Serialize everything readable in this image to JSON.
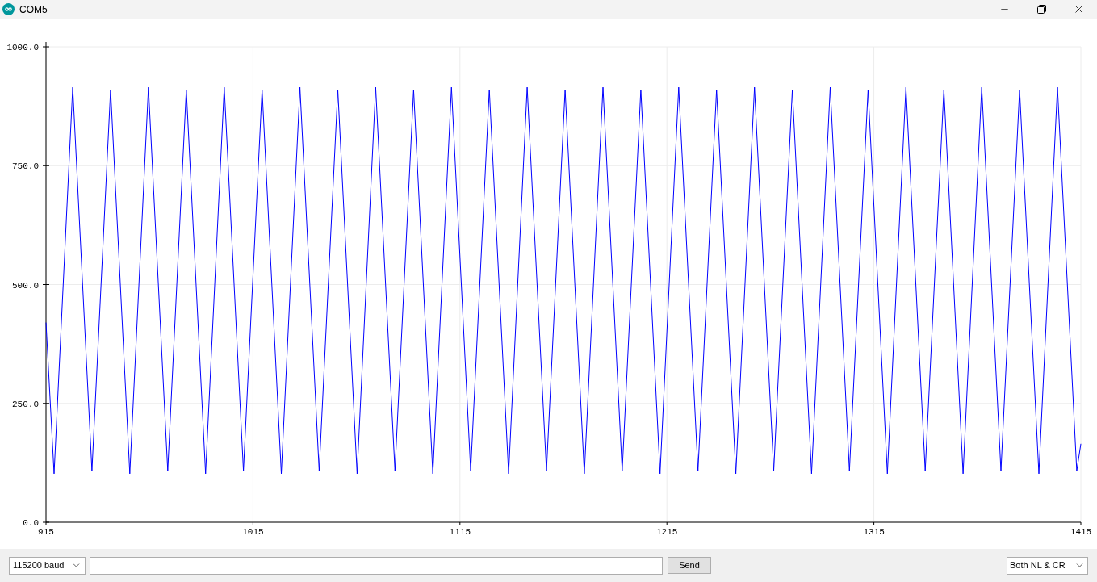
{
  "window": {
    "title": "COM5"
  },
  "plot": {
    "chart_data": {
      "type": "line",
      "x": [
        915,
        918.9,
        927.9,
        937.2,
        946.2,
        955.5,
        964.5,
        973.8,
        982.8,
        992.1,
        1001.1,
        1010.4,
        1019.4,
        1028.7,
        1037.7,
        1047.0,
        1056.0,
        1065.3,
        1074.3,
        1083.6,
        1092.6,
        1101.9,
        1110.9,
        1120.2,
        1129.2,
        1138.5,
        1147.5,
        1156.8,
        1165.8,
        1175.1,
        1184.1,
        1193.4,
        1202.4,
        1211.7,
        1220.7,
        1230.0,
        1239.0,
        1248.3,
        1257.3,
        1266.6,
        1275.6,
        1284.9,
        1293.9,
        1303.2,
        1312.2,
        1321.5,
        1330.5,
        1339.8,
        1348.8,
        1358.1,
        1367.1,
        1376.4,
        1385.4,
        1394.7,
        1403.7,
        1413.0,
        1415
      ],
      "series": [
        {
          "color": "#0000ff",
          "values": [
            420,
            102,
            915,
            108,
            910,
            102,
            915,
            108,
            910,
            102,
            915,
            108,
            910,
            102,
            915,
            108,
            910,
            102,
            915,
            108,
            910,
            102,
            915,
            108,
            910,
            102,
            915,
            108,
            910,
            102,
            915,
            108,
            910,
            102,
            915,
            108,
            910,
            102,
            915,
            108,
            910,
            102,
            915,
            108,
            910,
            102,
            915,
            108,
            910,
            102,
            915,
            108,
            910,
            102,
            915,
            108,
            165
          ]
        }
      ],
      "grid": true,
      "xlim": [
        915,
        1415
      ],
      "ylim": [
        0,
        1000
      ],
      "xticks": [
        915,
        1015,
        1115,
        1215,
        1315,
        1415
      ],
      "yticks": [
        {
          "value": 0,
          "label": "0.0"
        },
        {
          "value": 250,
          "label": "250.0"
        },
        {
          "value": 500,
          "label": "500.0"
        },
        {
          "value": 750,
          "label": "750.0"
        },
        {
          "value": 1000,
          "label": "1000.0"
        }
      ]
    }
  },
  "bottom_bar": {
    "baud_rate": "115200 baud",
    "send_button": "Send",
    "line_ending": "Both NL & CR"
  }
}
